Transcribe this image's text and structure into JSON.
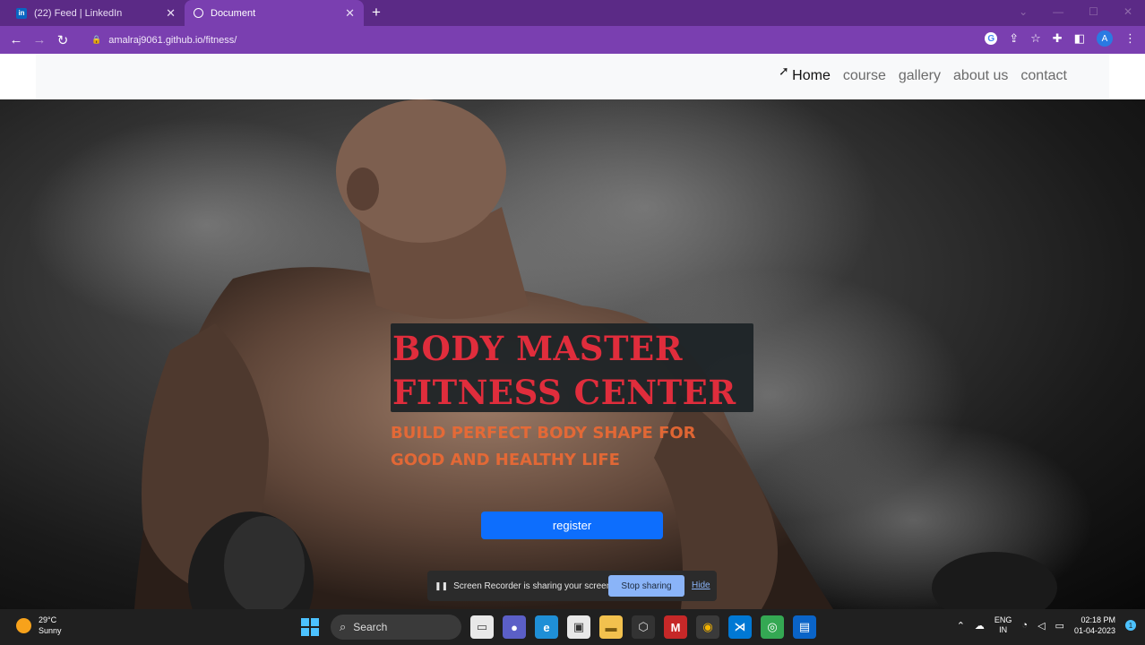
{
  "browser": {
    "tabs": [
      {
        "label": "(22) Feed | LinkedIn",
        "favicon": "in"
      },
      {
        "label": "Document",
        "active": true
      }
    ],
    "new_tab": "+",
    "address": "amalraj9061.github.io/fitness/"
  },
  "nav": {
    "links": [
      {
        "label": "Home",
        "active": true
      },
      {
        "label": "course"
      },
      {
        "label": "gallery"
      },
      {
        "label": "about us"
      },
      {
        "label": "contact"
      }
    ]
  },
  "hero": {
    "title_line1": "BODY MASTER",
    "title_line2": "FITNESS CENTER",
    "tagline": "BUILD PERFECT BODY SHAPE FOR GOOD AND HEALTHY LIFE",
    "register_label": "register"
  },
  "share_bar": {
    "message": "Screen Recorder is sharing your screen.",
    "stop_label": "Stop sharing",
    "hide_label": "Hide"
  },
  "taskbar": {
    "weather_temp": "29°C",
    "weather_desc": "Sunny",
    "search_label": "Search",
    "lang_line1": "ENG",
    "lang_line2": "IN",
    "time": "02:18 PM",
    "date": "01-04-2023"
  },
  "colors": {
    "chrome_purple": "#7a3fb0",
    "tabstrip_purple": "#5b2a86",
    "title_red": "#e02d3c",
    "tagline_orange": "#ee6a34",
    "register_blue": "#0d6efd"
  }
}
